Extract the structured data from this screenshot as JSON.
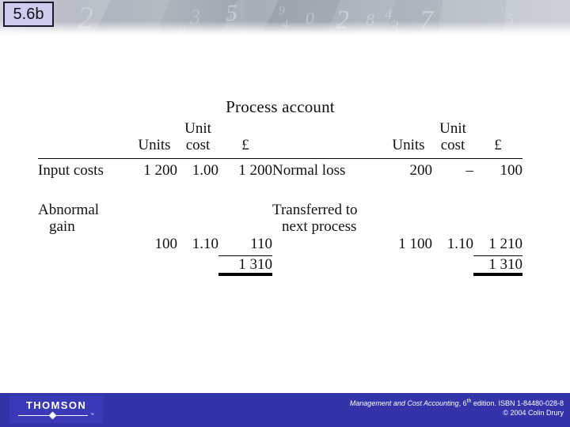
{
  "slide": {
    "badge_label": "5.6b"
  },
  "account": {
    "title": "Process account",
    "columns_left": {
      "description": "",
      "units": "Units",
      "unit_cost": "Unit\ncost",
      "amount": "£"
    },
    "columns_right": {
      "description": "",
      "units": "Units",
      "unit_cost": "Unit\ncost",
      "amount": "£"
    },
    "rows_left": [
      {
        "description": "Input costs",
        "description_line2": "",
        "units": "1 200",
        "unit_cost": "1.00",
        "amount": "1 200"
      },
      {
        "description": "Abnormal",
        "description_line2": "gain",
        "units": "100",
        "unit_cost": "1.10",
        "amount": "110"
      }
    ],
    "rows_right": [
      {
        "description": "Normal loss",
        "description_line2": "",
        "units": "200",
        "unit_cost": "–",
        "amount": "100"
      },
      {
        "description": "Transferred to",
        "description_line2": "next process",
        "units": "1 100",
        "unit_cost": "1.10",
        "amount": "1 210"
      }
    ],
    "total_left": "1 310",
    "total_right": "1 310"
  },
  "footer": {
    "logo_word": "THOMSON",
    "logo_tm": "™",
    "credit_title": "Management and Cost Accounting",
    "credit_rest": ", 6",
    "credit_sup": "th",
    "credit_tail": " edition. ISBN 1-84480-028-8",
    "credit_copyright": "© 2004 Colin Drury"
  },
  "colors": {
    "badge_fill": "#ccccee",
    "badge_border": "#1a1a2e",
    "footer_bar": "#3333aa",
    "logo_block": "#3a3ab8",
    "rule": "#000000"
  }
}
